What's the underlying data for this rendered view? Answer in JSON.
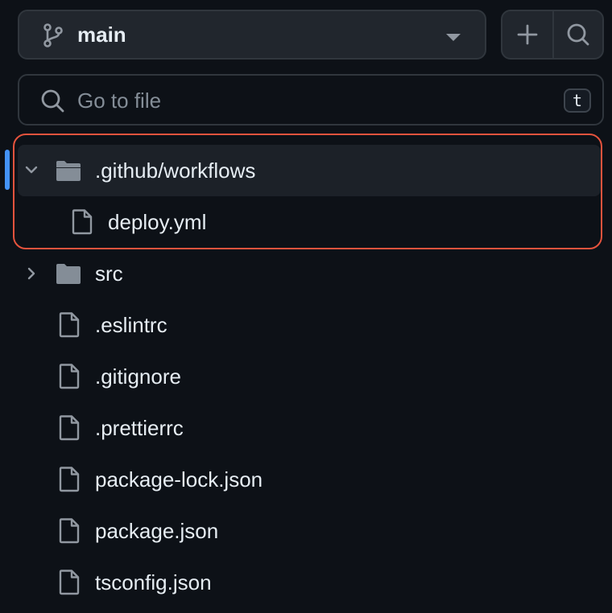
{
  "header": {
    "branch_name": "main",
    "add_file_label": "+",
    "search_files_label": ""
  },
  "file_search": {
    "placeholder": "Go to file",
    "shortcut": "t"
  },
  "tree": {
    "items": [
      {
        "label": ".github/workflows",
        "type": "folder",
        "expanded": true,
        "selected": true
      },
      {
        "label": "deploy.yml",
        "type": "file",
        "depth": 1
      },
      {
        "label": "src",
        "type": "folder",
        "expanded": false
      },
      {
        "label": ".eslintrc",
        "type": "file"
      },
      {
        "label": ".gitignore",
        "type": "file"
      },
      {
        "label": ".prettierrc",
        "type": "file"
      },
      {
        "label": "package-lock.json",
        "type": "file"
      },
      {
        "label": "package.json",
        "type": "file"
      },
      {
        "label": "tsconfig.json",
        "type": "file"
      }
    ]
  },
  "colors": {
    "background": "#0d1117",
    "accent": "#4493f8",
    "highlight_border": "#e5533d",
    "folder": "#848d97"
  }
}
